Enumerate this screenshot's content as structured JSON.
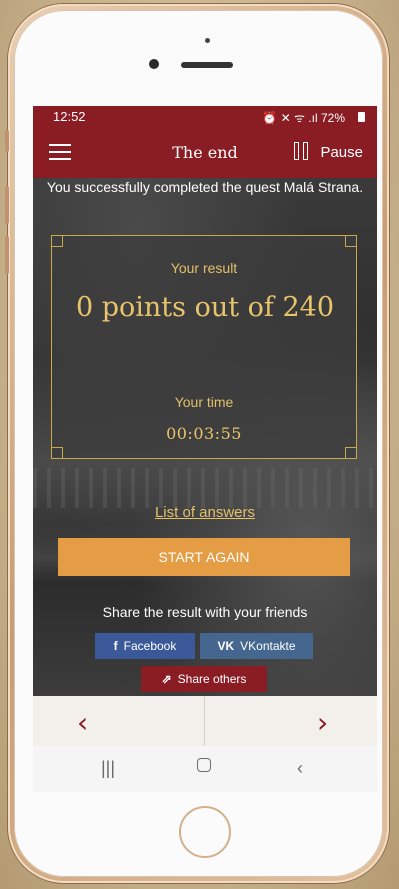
{
  "status_bar": {
    "time": "12:52",
    "battery": "72%",
    "icons": "⏰ ✕ ᯤ .ıl"
  },
  "app_bar": {
    "title": "The end",
    "pause_label": "Pause"
  },
  "main": {
    "completion_message": "You successfully completed the quest Malá Strana.",
    "result_label": "Your result",
    "score_text": "0 points out of 240",
    "time_label": "Your time",
    "time_value": "00:03:55",
    "answers_link": "List of answers",
    "start_again_label": "START AGAIN",
    "share_title": "Share the result with your friends",
    "share_buttons": {
      "facebook": "Facebook",
      "vkontakte": "VKontakte",
      "others": "Share others"
    }
  },
  "colors": {
    "brand": "#8a1c24",
    "gold": "#e3c06a",
    "button": "#e49c45",
    "facebook": "#3b5998",
    "vk": "#45668e"
  }
}
